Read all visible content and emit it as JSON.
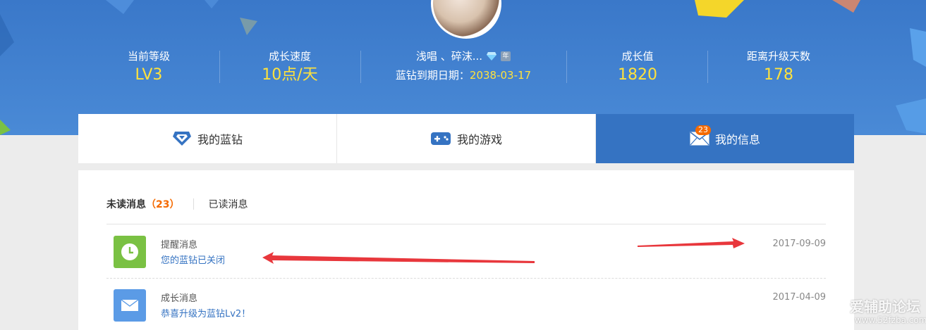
{
  "stats": {
    "level": {
      "label": "当前等级",
      "value": "LV3"
    },
    "speed": {
      "label": "成长速度",
      "value": "10点/天"
    },
    "user": {
      "name": "浅唱 、碎沫...",
      "year_badge": "年",
      "expire_label": "蓝钻到期日期：",
      "expire_date": "2038-03-17"
    },
    "growth": {
      "label": "成长值",
      "value": "1820"
    },
    "days_to_upgrade": {
      "label": "距离升级天数",
      "value": "178"
    }
  },
  "tabs": [
    {
      "label": "我的蓝钻",
      "icon": "diamond-icon"
    },
    {
      "label": "我的游戏",
      "icon": "gamepad-icon"
    },
    {
      "label": "我的信息",
      "icon": "mail-icon",
      "badge": "23",
      "active": true
    }
  ],
  "subtabs": {
    "unread_label": "未读消息",
    "unread_count": "（23）",
    "read_label": "已读消息"
  },
  "messages": [
    {
      "type": "提醒消息",
      "text": "您的蓝钻已关闭",
      "date": "2017-09-09",
      "icon": "clock-icon",
      "icon_color": "#7ac143"
    },
    {
      "type": "成长消息",
      "text": "恭喜升级为蓝钻Lv2！",
      "date": "2017-04-09",
      "icon": "mail-icon",
      "icon_color": "#5b9be6"
    }
  ],
  "watermark": {
    "line1": "爱辅助论坛",
    "line2": "www.52fzba.com"
  },
  "colors": {
    "accent": "#3573c2",
    "highlight": "#ffe23c",
    "badge": "#f56a00",
    "annotation_arrow": "#e8373c"
  }
}
